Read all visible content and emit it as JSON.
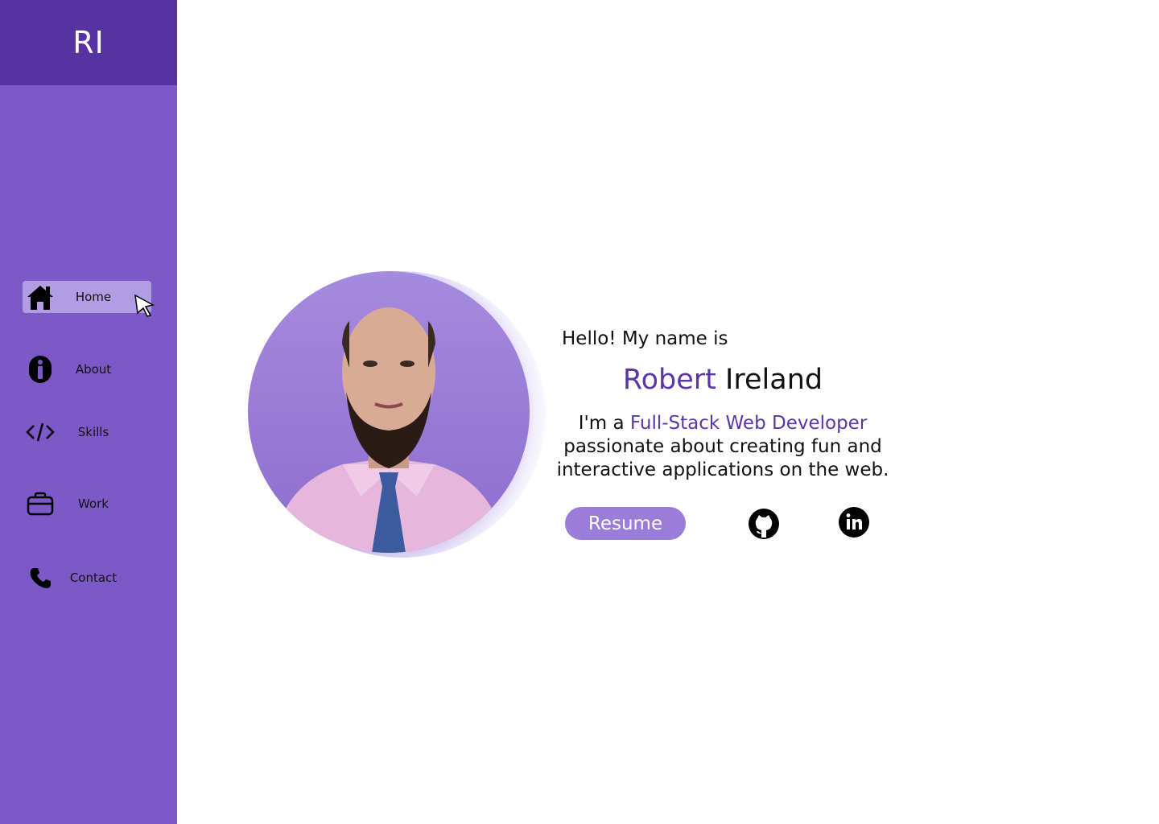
{
  "sidebar": {
    "brand": "RI",
    "items": [
      {
        "label": "Home",
        "icon": "home-icon",
        "active": true
      },
      {
        "label": "About",
        "icon": "info-icon",
        "active": false
      },
      {
        "label": "Skills",
        "icon": "code-icon",
        "active": false
      },
      {
        "label": "Work",
        "icon": "briefcase-icon",
        "active": false
      },
      {
        "label": "Contact",
        "icon": "phone-icon",
        "active": false
      }
    ]
  },
  "hero": {
    "greeting": "Hello! My name is",
    "first_name": "Robert",
    "last_name": "Ireland",
    "intro_prefix": "I'm a",
    "role": "Full-Stack Web Developer",
    "description": "passionate about creating fun and interactive applications on the web.",
    "resume_label": "Resume",
    "socials": [
      {
        "icon": "github-icon"
      },
      {
        "icon": "linkedin-icon"
      }
    ]
  },
  "colors": {
    "sidebar": "#7c59c6",
    "brand_bar": "#5633a0",
    "active_item": "#b19de2",
    "accent_text": "#5a36a6",
    "button": "#9a7cd9"
  }
}
